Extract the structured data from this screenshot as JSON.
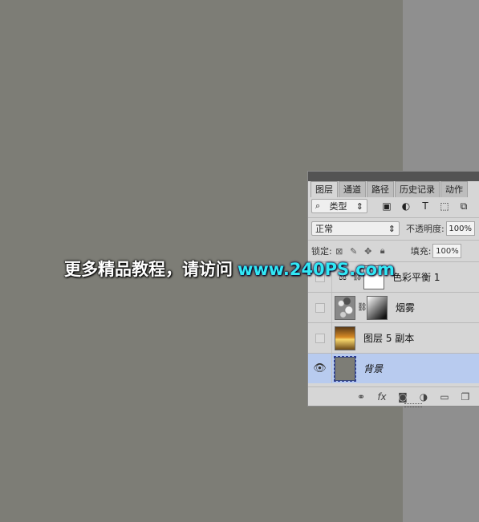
{
  "panel": {
    "tabs": [
      {
        "label": "图层",
        "active": true
      },
      {
        "label": "通道",
        "active": false
      },
      {
        "label": "路径",
        "active": false
      },
      {
        "label": "历史记录",
        "active": false
      },
      {
        "label": "动作",
        "active": false
      }
    ],
    "filter": {
      "label": "类型",
      "icons": [
        "image-filter-icon",
        "adjustment-filter-icon",
        "text-filter-icon",
        "shape-filter-icon",
        "smart-object-filter-icon"
      ]
    },
    "blend_mode": "正常",
    "opacity_label": "不透明度:",
    "opacity_value": "100%",
    "lock_label": "锁定:",
    "fill_label": "填充:",
    "fill_value": "100%",
    "layers": [
      {
        "name": "色彩平衡 1",
        "visible": false,
        "thumb": "adjustment",
        "has_mask": true
      },
      {
        "name": "烟雾",
        "visible": false,
        "thumb": "smoke",
        "has_mask": true
      },
      {
        "name": "图层 5 副本",
        "visible": false,
        "thumb": "sunset",
        "has_mask": false
      },
      {
        "name": "背景",
        "visible": true,
        "thumb": "gray",
        "selected": true
      }
    ],
    "bottom_icons": [
      "link-layers-icon",
      "fx-icon",
      "add-mask-icon",
      "new-adjustment-icon",
      "new-group-icon",
      "new-layer-icon"
    ]
  },
  "watermark": {
    "text_cn": "更多精品教程，请访问",
    "url": "www.240PS.com"
  }
}
